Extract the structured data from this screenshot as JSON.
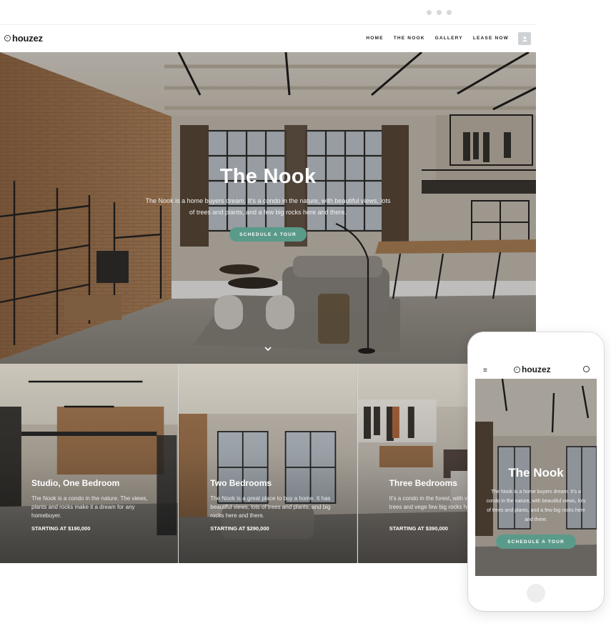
{
  "window": {
    "dots": [
      "dot",
      "dot",
      "dot"
    ]
  },
  "brand": {
    "logo_text": "houzez",
    "accent": "#5a9a8a"
  },
  "nav": {
    "items": [
      "HOME",
      "THE NOOK",
      "GALLERY",
      "LEASE NOW"
    ],
    "user_icon": "user-icon"
  },
  "hero": {
    "title": "The Nook",
    "description": "The Nook is a home buyers dream. It's a condo in the nature, with beautiful views, lots of trees and plants, and a few big rocks here and there.",
    "cta": "SCHEDULE A TOUR",
    "scroll_icon": "chevron-down-icon"
  },
  "cards": [
    {
      "title": "Studio, One Bedroom",
      "description": "The Nook is a condo in the nature. The views, plants and rocks make it a dream for any homebuyer.",
      "price": "STARTING AT $190,000"
    },
    {
      "title": "Two Bedrooms",
      "description": "The Nook is a great place to buy a home. It has beautiful views, lots of trees and plants, and big rocks here and there.",
      "price": "STARTING AT $290,000"
    },
    {
      "title": "Three Bedrooms",
      "description": "It's a condo in the forest, with views, lots of trees and vege few big rocks here and there.",
      "price": "STARTING AT $390,000"
    }
  ],
  "mobile": {
    "logo_text": "houzez",
    "menu_icon": "hamburger-menu-icon",
    "user_icon": "user-icon",
    "title": "The Nook",
    "description": "The Nook is a home buyers dream. It's a condo in the nature, with beautiful views, lots of trees and plants, and a few big rocks here and there.",
    "cta": "SCHEDULE A TOUR"
  }
}
